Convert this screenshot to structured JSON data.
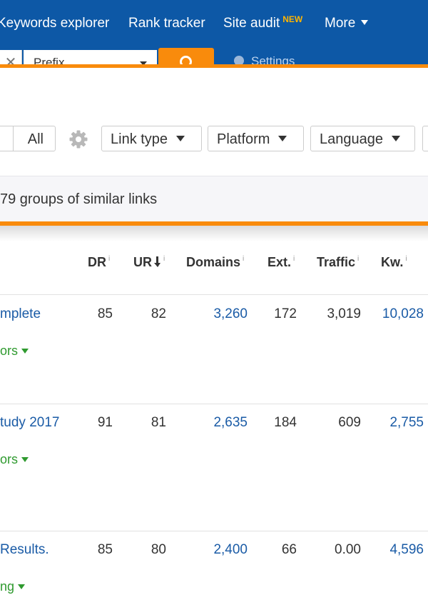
{
  "nav": {
    "items": [
      {
        "label": "Keywords explorer"
      },
      {
        "label": "Rank tracker"
      },
      {
        "label": "Site audit",
        "badge": "NEW"
      },
      {
        "label": "More"
      }
    ]
  },
  "search": {
    "clear_icon": "close-icon",
    "mode": "Prefix",
    "button_icon": "search-icon",
    "settings_label": "Settings"
  },
  "filters": {
    "all_label": "All",
    "settings_icon": "gear-icon",
    "link_type": "Link type",
    "platform": "Platform",
    "language": "Language"
  },
  "summary": {
    "groups_text": "79 groups of similar links"
  },
  "table": {
    "headers": {
      "dr": "DR",
      "ur": "UR",
      "domains": "Domains",
      "ext": "Ext.",
      "traffic": "Traffic",
      "kw": "Kw.",
      "info": "i"
    },
    "rows": [
      {
        "title": "mplete",
        "sub": "ors",
        "dr": "85",
        "ur": "82",
        "domains": "3,260",
        "ext": "172",
        "traffic": "3,019",
        "kw": "10,028"
      },
      {
        "title": "tudy 2017",
        "sub": "ors",
        "dr": "91",
        "ur": "81",
        "domains": "2,635",
        "ext": "184",
        "traffic": "609",
        "kw": "2,755"
      },
      {
        "title": "Results.",
        "sub": "ng",
        "dr": "85",
        "ur": "80",
        "domains": "2,400",
        "ext": "66",
        "traffic": "0.00",
        "kw": "4,596"
      }
    ]
  },
  "colors": {
    "nav_bg": "#0d58a6",
    "accent_orange": "#f98b0c",
    "link_blue": "#1a5ba6",
    "green": "#2f9a2f"
  }
}
